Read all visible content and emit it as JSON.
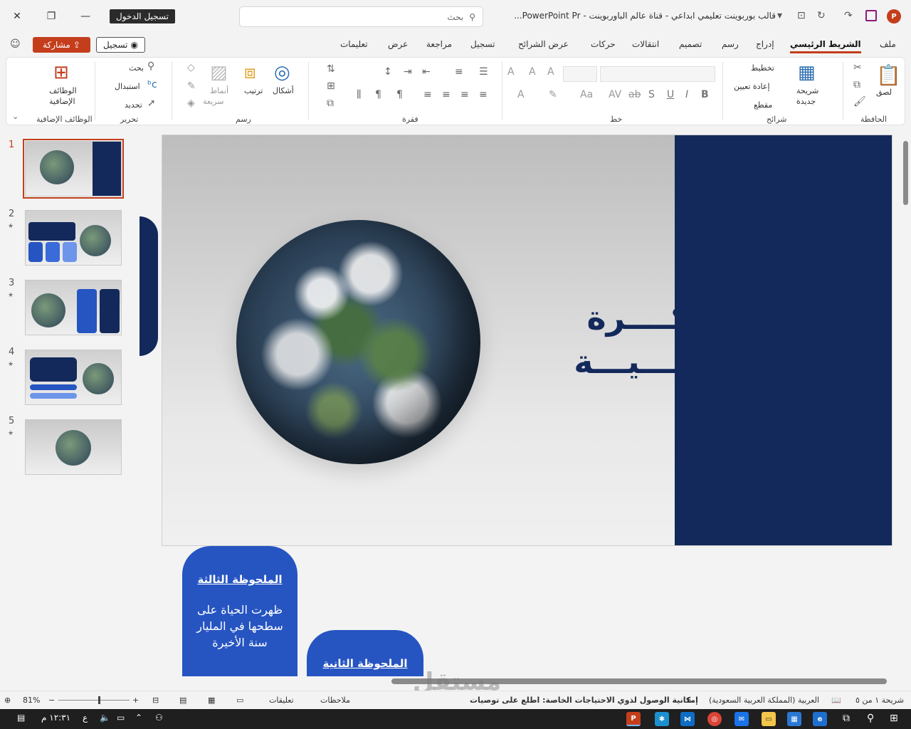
{
  "titlebar": {
    "signin_label": "تسجيل الدخول",
    "search_placeholder": "بحث",
    "doc_title": "قالب بوربوينت تعليمي ابداعي - قناة عالم الباوربوينت  -  PowerPoint Pr...",
    "app_logo": "P"
  },
  "tabs": {
    "file": "ملف",
    "home": "الشريط الرئيسي",
    "insert": "إدراج",
    "draw": "رسم",
    "design": "تصميم",
    "transitions": "انتقالات",
    "animations": "حركات",
    "slideshow": "عرض الشرائح",
    "record": "تسجيل",
    "review": "مراجعة",
    "view": "عرض",
    "help": "تعليمات",
    "share": "مشاركة",
    "record_btn": "تسجيل"
  },
  "ribbon": {
    "clipboard": {
      "paste": "لصق",
      "label": "الحافظة"
    },
    "slides": {
      "new_slide": "شريحة",
      "new_slide2": "جديدة",
      "layout": "تخطيط",
      "reset": "إعادة تعيين",
      "section": "مقطع",
      "label": "شرائح"
    },
    "font": {
      "label": "خط"
    },
    "paragraph": {
      "label": "فقرة"
    },
    "drawing": {
      "shapes": "أشكال",
      "arrange": "ترتيب",
      "quick_styles": "أنماط",
      "quick_styles2": "سريعة",
      "label": "رسم"
    },
    "editing": {
      "find": "بحث",
      "replace": "استبدال",
      "select": "تحديد",
      "label": "تحرير"
    },
    "addins": {
      "addins": "الوظائف",
      "addins2": "الإضافية",
      "label": "الوظائف الإضافية"
    }
  },
  "thumbnails": [
    {
      "num": "1",
      "star": ""
    },
    {
      "num": "2",
      "star": "★"
    },
    {
      "num": "3",
      "star": "★"
    },
    {
      "num": "4",
      "star": "★"
    },
    {
      "num": "5",
      "star": "★"
    }
  ],
  "slide": {
    "title_line1": "الـــــكــــرة",
    "title_line2": "الارضـــــيـــة"
  },
  "notes": {
    "third_title": "الملحوظة الثالثة",
    "third_body": "ظهرت الحياة على سطحها في المليار سنة الأخيرة",
    "second_title": "الملحوظة الثانية"
  },
  "statusbar": {
    "slide_info": "شريحة ١ من ٥",
    "language": "العربية (المملكة العربية السعودية)",
    "accessibility": "إمكانية الوصول لذوي الاحتياجات الخاصة: اطلع على توصيات",
    "notes": "ملاحظات",
    "comments": "تعليقات",
    "zoom": "81%"
  },
  "taskbar": {
    "time": "١٢:٣١ م",
    "lang": "ع"
  },
  "watermark": {
    "ar": "مستقل",
    "en": "mostaql.com"
  },
  "colors": {
    "accent": "#c43e1c",
    "navy": "#13295b",
    "card_blue": "#2655c2"
  }
}
